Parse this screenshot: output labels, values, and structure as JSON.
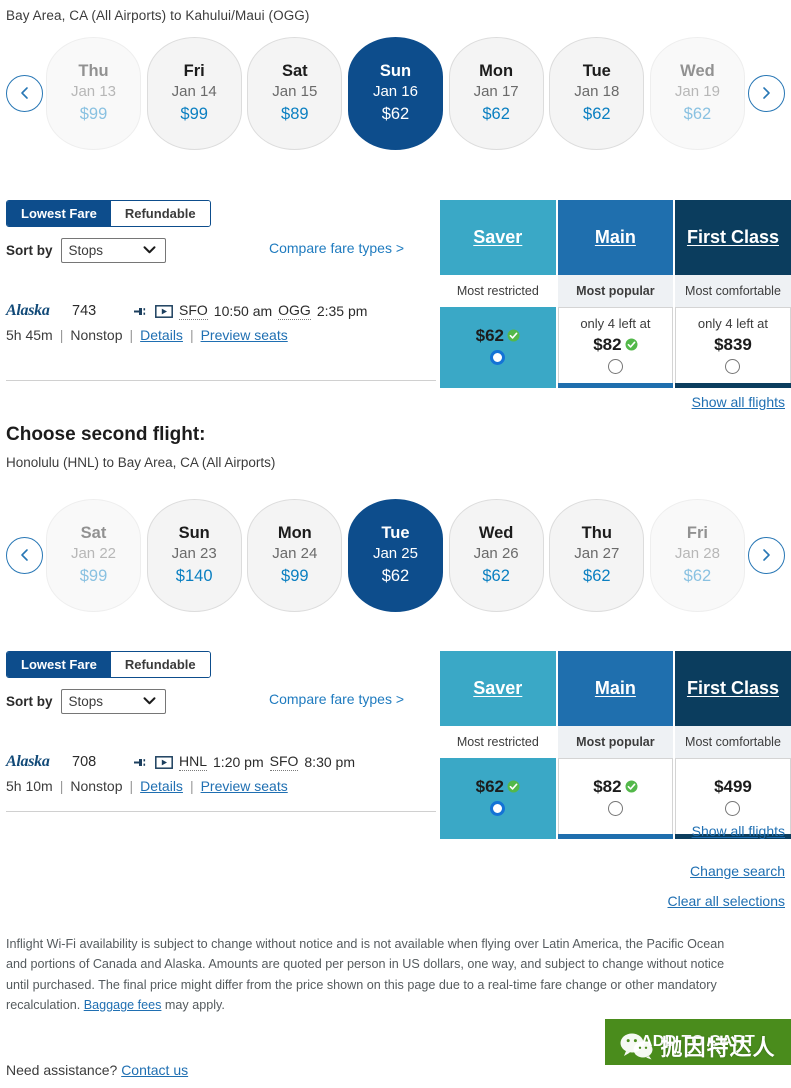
{
  "outbound": {
    "route": "Bay Area, CA (All Airports) to Kahului/Maui (OGG)",
    "dates": [
      {
        "dow": "Thu",
        "dom": "Jan 13",
        "price": "$99",
        "selected": false,
        "faded": true
      },
      {
        "dow": "Fri",
        "dom": "Jan 14",
        "price": "$99",
        "selected": false,
        "faded": false
      },
      {
        "dow": "Sat",
        "dom": "Jan 15",
        "price": "$89",
        "selected": false,
        "faded": false
      },
      {
        "dow": "Sun",
        "dom": "Jan 16",
        "price": "$62",
        "selected": true,
        "faded": false
      },
      {
        "dow": "Mon",
        "dom": "Jan 17",
        "price": "$62",
        "selected": false,
        "faded": false
      },
      {
        "dow": "Tue",
        "dom": "Jan 18",
        "price": "$62",
        "selected": false,
        "faded": false
      },
      {
        "dow": "Wed",
        "dom": "Jan 19",
        "price": "$62",
        "selected": false,
        "faded": true
      }
    ],
    "prev_label": "previous dates",
    "next_label": "next dates",
    "tab_lowest": "Lowest Fare",
    "tab_refundable": "Refundable",
    "sort_label": "Sort by",
    "sort_value": "Stops",
    "compare_link": "Compare fare types >",
    "fares": [
      {
        "name": "Saver",
        "tagline": "Most restricted",
        "avail": "",
        "amount": "$62",
        "selected": true,
        "discount": true,
        "color": "#3aa8c6"
      },
      {
        "name": "Main",
        "tagline": "Most popular",
        "avail": "only 4 left at",
        "amount": "$82",
        "selected": false,
        "discount": true,
        "color": "#1f6fae"
      },
      {
        "name": "First Class",
        "tagline": "Most comfortable",
        "avail": "only 4 left at",
        "amount": "$839",
        "selected": false,
        "discount": false,
        "color": "#0b3d5e"
      }
    ],
    "flight": {
      "airline": "Alaska",
      "number": "743",
      "origin": "SFO",
      "depart": "10:50 am",
      "destination": "OGG",
      "arrive": "2:35 pm",
      "duration": "5h 45m",
      "stops": "Nonstop",
      "details_link": "Details",
      "seats_link": "Preview seats"
    },
    "show_all": "Show all flights"
  },
  "inbound": {
    "title": "Choose second flight:",
    "route": "Honolulu (HNL) to Bay Area, CA (All Airports)",
    "dates": [
      {
        "dow": "Sat",
        "dom": "Jan 22",
        "price": "$99",
        "selected": false,
        "faded": true
      },
      {
        "dow": "Sun",
        "dom": "Jan 23",
        "price": "$140",
        "selected": false,
        "faded": false
      },
      {
        "dow": "Mon",
        "dom": "Jan 24",
        "price": "$99",
        "selected": false,
        "faded": false
      },
      {
        "dow": "Tue",
        "dom": "Jan 25",
        "price": "$62",
        "selected": true,
        "faded": false
      },
      {
        "dow": "Wed",
        "dom": "Jan 26",
        "price": "$62",
        "selected": false,
        "faded": false
      },
      {
        "dow": "Thu",
        "dom": "Jan 27",
        "price": "$62",
        "selected": false,
        "faded": false
      },
      {
        "dow": "Fri",
        "dom": "Jan 28",
        "price": "$62",
        "selected": false,
        "faded": true
      }
    ],
    "prev_label": "previous dates",
    "next_label": "next dates",
    "tab_lowest": "Lowest Fare",
    "tab_refundable": "Refundable",
    "sort_label": "Sort by",
    "sort_value": "Stops",
    "compare_link": "Compare fare types >",
    "fares": [
      {
        "name": "Saver",
        "tagline": "Most restricted",
        "avail": "",
        "amount": "$62",
        "selected": true,
        "discount": true,
        "color": "#3aa8c6"
      },
      {
        "name": "Main",
        "tagline": "Most popular",
        "avail": "",
        "amount": "$82",
        "selected": false,
        "discount": true,
        "color": "#1f6fae"
      },
      {
        "name": "First Class",
        "tagline": "Most comfortable",
        "avail": "",
        "amount": "$499",
        "selected": false,
        "discount": false,
        "color": "#0b3d5e"
      }
    ],
    "flight": {
      "airline": "Alaska",
      "number": "708",
      "origin": "HNL",
      "depart": "1:20 pm",
      "destination": "SFO",
      "arrive": "8:30 pm",
      "duration": "5h 10m",
      "stops": "Nonstop",
      "details_link": "Details",
      "seats_link": "Preview seats"
    },
    "show_all": "Show all flights"
  },
  "footer": {
    "change_search": "Change search",
    "clear_selections": "Clear all selections",
    "disclaimer_part1": "Inflight Wi-Fi availability is subject to change without notice and is not available when flying over Latin America, the Pacific Ocean and portions of Canada and Alaska. Amounts are quoted per person in US dollars, one way, and subject to change without notice until purchased. The final price might differ from the price shown on this page due to a real-time fare change or other mandatory recalculation. ",
    "baggage_link": "Baggage fees",
    "disclaimer_part2": " may apply.",
    "add_to_cart": "ADD TO CART",
    "assistance_text": "Need assistance? ",
    "contact_link": "Contact us",
    "watermark_text": "抛因特达人"
  },
  "colors": {
    "brand_navy": "#0d4d8c",
    "link_blue": "#1f6fb2",
    "saver_teal": "#3aa8c6",
    "main_blue": "#1f6fae",
    "first_navy": "#0b3d5e",
    "cart_green": "#4a8c1c"
  }
}
